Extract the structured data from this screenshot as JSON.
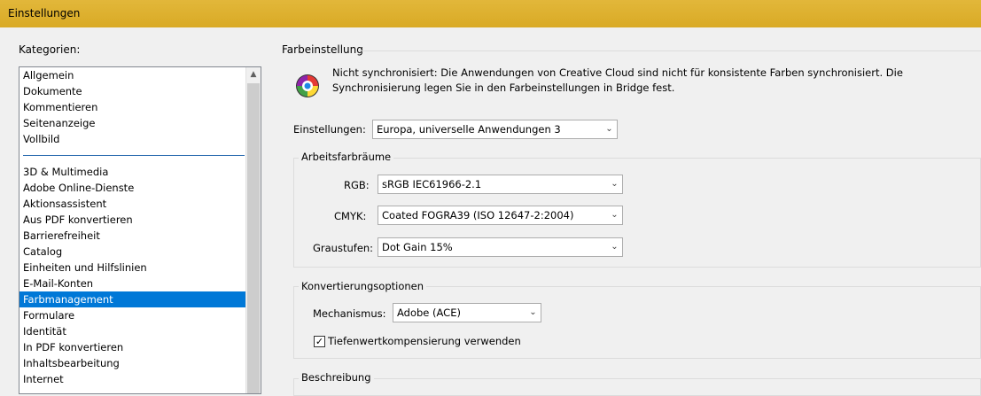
{
  "window": {
    "title": "Einstellungen"
  },
  "categories": {
    "label": "Kategorien:",
    "group1": [
      "Allgemein",
      "Dokumente",
      "Kommentieren",
      "Seitenanzeige",
      "Vollbild"
    ],
    "group2": [
      "3D & Multimedia",
      "Adobe Online-Dienste",
      "Aktionsassistent",
      "Aus PDF konvertieren",
      "Barrierefreiheit",
      "Catalog",
      "Einheiten und Hilfslinien",
      "E-Mail-Konten",
      "Farbmanagement",
      "Formulare",
      "Identität",
      "In PDF konvertieren",
      "Inhaltsbearbeitung",
      "Internet"
    ],
    "selected": "Farbmanagement"
  },
  "panel": {
    "title": "Farbeinstellung",
    "info_icon": "color-wheel-icon",
    "info_text": "Nicht synchronisiert: Die Anwendungen von Creative Cloud sind nicht für konsistente Farben synchronisiert. Die Synchronisierung legen Sie in den Farbeinstellungen in Bridge fest.",
    "settings_label": "Einstellungen:",
    "settings_value": "Europa, universelle Anwendungen 3",
    "workspaces": {
      "title": "Arbeitsfarbräume",
      "rgb_label": "RGB:",
      "rgb_value": "sRGB IEC61966-2.1",
      "cmyk_label": "CMYK:",
      "cmyk_value": "Coated FOGRA39 (ISO 12647-2:2004)",
      "gray_label": "Graustufen:",
      "gray_value": "Dot Gain 15%"
    },
    "conversion": {
      "title": "Konvertierungsoptionen",
      "engine_label": "Mechanismus:",
      "engine_value": "Adobe (ACE)",
      "bpc_label": "Tiefenwertkompensierung verwenden",
      "bpc_checked": true
    },
    "description": {
      "title": "Beschreibung"
    }
  }
}
